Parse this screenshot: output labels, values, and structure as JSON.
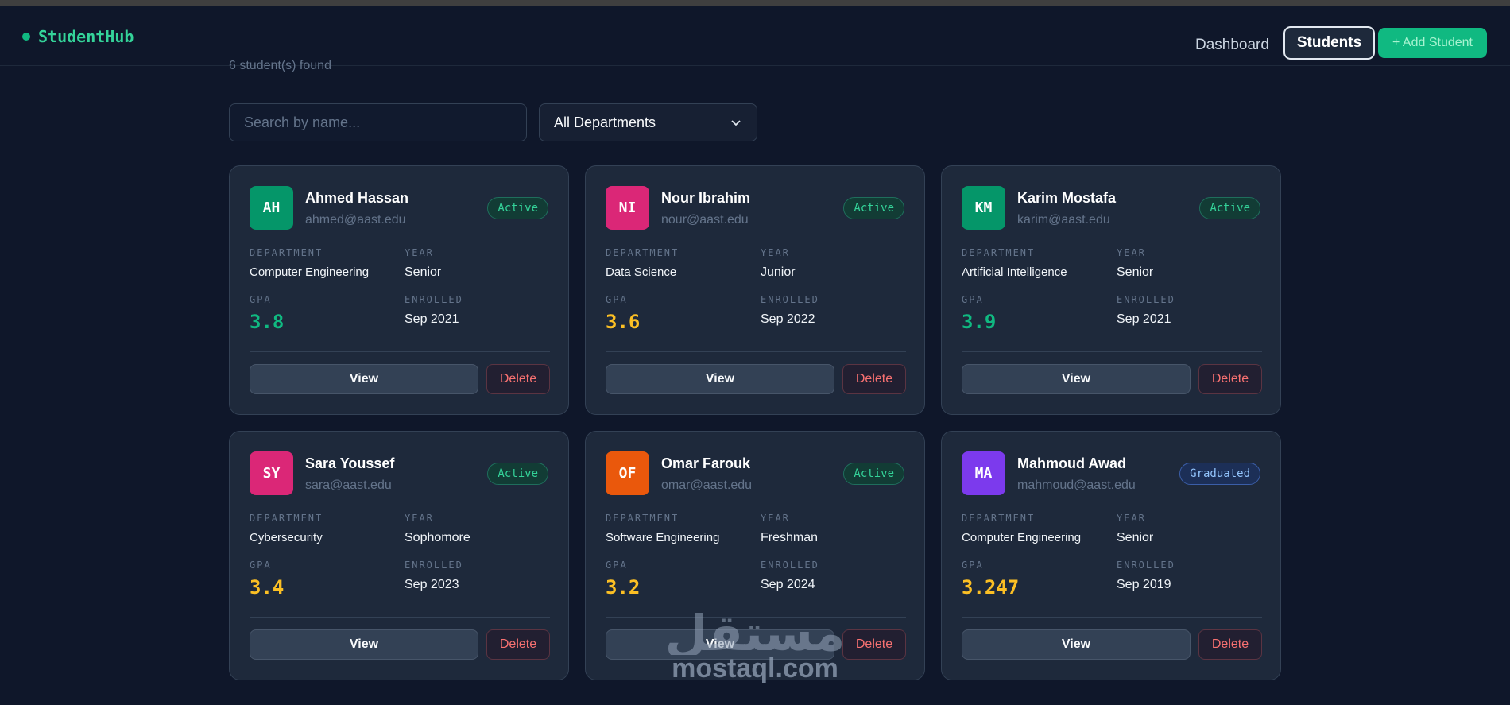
{
  "nav": {
    "brand": "StudentHub",
    "dashboard": "Dashboard",
    "students": "Students",
    "add_student": "+ Add Student"
  },
  "results": {
    "count": "6 student(s) found"
  },
  "filters": {
    "search_placeholder": "Search by name...",
    "department": "All Departments"
  },
  "labels": {
    "department": "DEPARTMENT",
    "year": "YEAR",
    "gpa": "GPA",
    "enrolled": "ENROLLED",
    "view": "View",
    "delete": "Delete"
  },
  "students": [
    {
      "initials": "AH",
      "name": "Ahmed Hassan",
      "email": "ahmed@aast.edu",
      "status": "Active",
      "department": "Computer Engineering",
      "year": "Senior",
      "gpa": "3.8",
      "enrolled": "Sep 2021",
      "avatar_color": "#059669",
      "gpa_color": "#10b981"
    },
    {
      "initials": "NI",
      "name": "Nour Ibrahim",
      "email": "nour@aast.edu",
      "status": "Active",
      "department": "Data Science",
      "year": "Junior",
      "gpa": "3.6",
      "enrolled": "Sep 2022",
      "avatar_color": "#db2777",
      "gpa_color": "#fbbf24"
    },
    {
      "initials": "KM",
      "name": "Karim Mostafa",
      "email": "karim@aast.edu",
      "status": "Active",
      "department": "Artificial Intelligence",
      "year": "Senior",
      "gpa": "3.9",
      "enrolled": "Sep 2021",
      "avatar_color": "#059669",
      "gpa_color": "#10b981"
    },
    {
      "initials": "SY",
      "name": "Sara Youssef",
      "email": "sara@aast.edu",
      "status": "Active",
      "department": "Cybersecurity",
      "year": "Sophomore",
      "gpa": "3.4",
      "enrolled": "Sep 2023",
      "avatar_color": "#db2777",
      "gpa_color": "#fbbf24"
    },
    {
      "initials": "OF",
      "name": "Omar Farouk",
      "email": "omar@aast.edu",
      "status": "Active",
      "department": "Software Engineering",
      "year": "Freshman",
      "gpa": "3.2",
      "enrolled": "Sep 2024",
      "avatar_color": "#ea580c",
      "gpa_color": "#fbbf24"
    },
    {
      "initials": "MA",
      "name": "Mahmoud Awad",
      "email": "mahmoud@aast.edu",
      "status": "Graduated",
      "department": "Computer Engineering",
      "year": "Senior",
      "gpa": "3.247",
      "enrolled": "Sep 2019",
      "avatar_color": "#7c3aed",
      "gpa_color": "#fbbf24"
    }
  ],
  "watermark": {
    "arabic": "مستقل",
    "url": "mostaql.com"
  },
  "colors": {
    "background": "#0f172a",
    "card": "#1e293b",
    "accent": "#10b981",
    "danger": "#f87171"
  },
  "icons": {
    "select_arrow": "chevron-down-icon",
    "brand_mark": "status-dot-icon"
  }
}
